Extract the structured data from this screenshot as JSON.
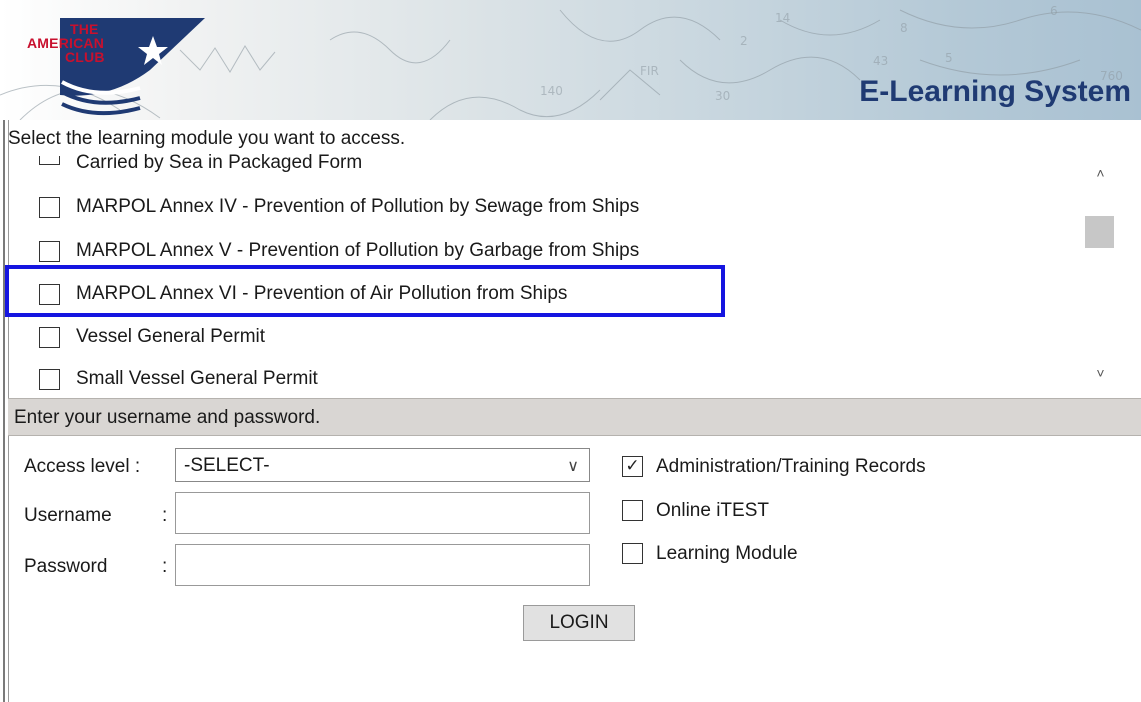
{
  "header": {
    "logo_lines": [
      "THE",
      "AMERICAN",
      "CLUB"
    ],
    "title": "E-Learning System"
  },
  "modules": {
    "prompt": "Select the learning module you want to access.",
    "items": [
      {
        "label": "Carried by Sea in Packaged Form",
        "checked": false
      },
      {
        "label": "MARPOL Annex IV - Prevention of Pollution by Sewage from Ships",
        "checked": false
      },
      {
        "label": "MARPOL Annex V - Prevention of Pollution by Garbage from Ships",
        "checked": false
      },
      {
        "label": "MARPOL Annex VI - Prevention of Air Pollution from Ships",
        "checked": false
      },
      {
        "label": "Vessel General Permit",
        "checked": false
      },
      {
        "label": "Small Vessel General Permit",
        "checked": false
      }
    ],
    "scroll": {
      "up_icon": "chevron-up-icon",
      "down_icon": "chevron-down-icon"
    }
  },
  "login": {
    "header": "Enter your username and password.",
    "access_level_label": "Access level :",
    "access_level_value": "-SELECT-",
    "username_label": "Username",
    "password_label": "Password",
    "colon": ":",
    "username_value": "",
    "password_value": "",
    "options": [
      {
        "label": "Administration/Training Records",
        "checked": true
      },
      {
        "label": "Online iTEST",
        "checked": false
      },
      {
        "label": "Learning Module",
        "checked": false
      }
    ],
    "login_button": "LOGIN"
  },
  "colors": {
    "highlight": "#1515e0",
    "title": "#1f3a73",
    "logo_red": "#c8102e",
    "logo_navy": "#1f3a73"
  }
}
